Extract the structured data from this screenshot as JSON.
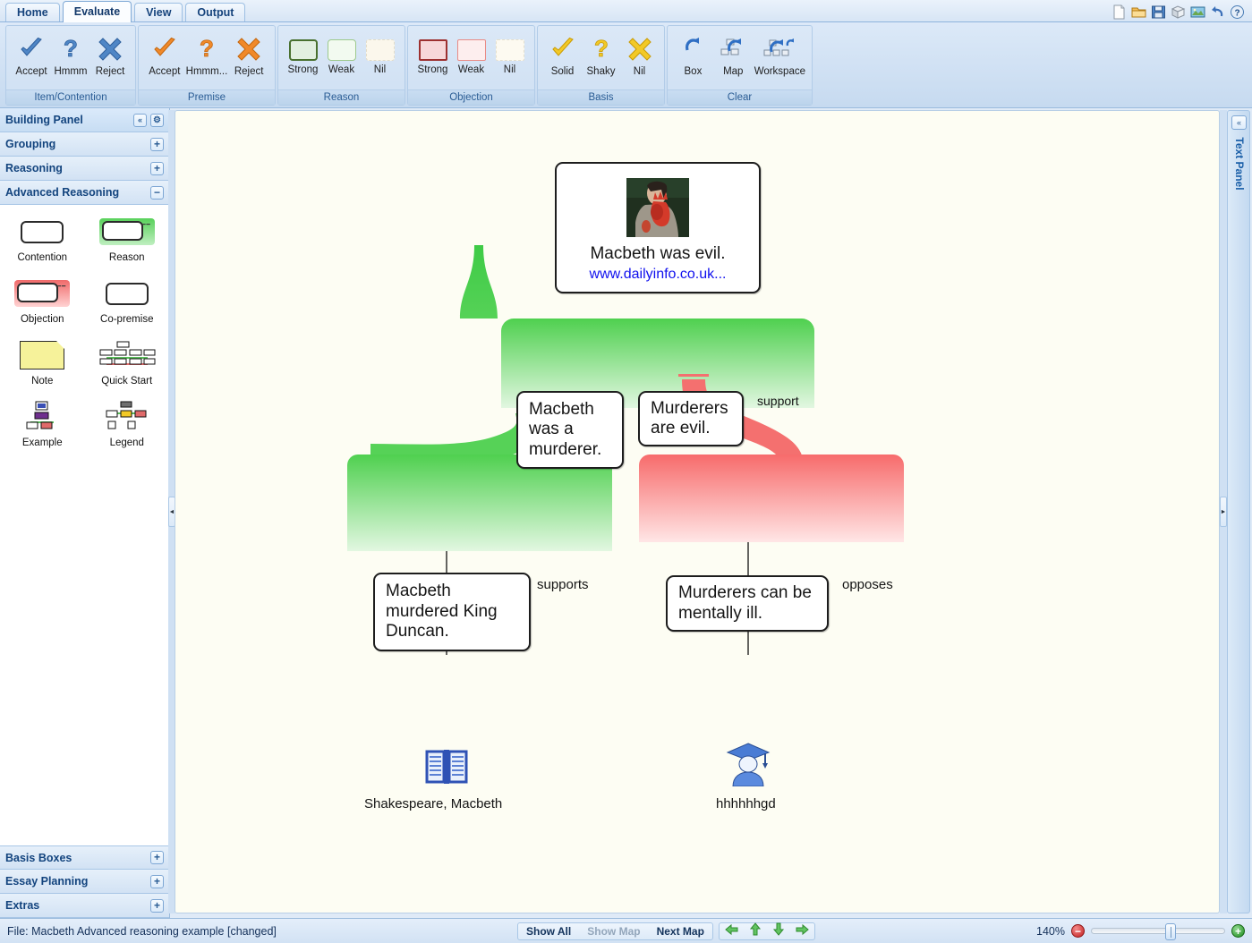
{
  "window": {
    "tabs": [
      {
        "label": "Home",
        "active": false
      },
      {
        "label": "Evaluate",
        "active": true
      },
      {
        "label": "View",
        "active": false
      },
      {
        "label": "Output",
        "active": false
      }
    ],
    "quick_access": [
      {
        "icon": "new-document-icon"
      },
      {
        "icon": "open-folder-icon"
      },
      {
        "icon": "save-disk-icon"
      },
      {
        "icon": "package-box-icon"
      },
      {
        "icon": "export-image-icon"
      },
      {
        "icon": "undo-arrow-icon"
      },
      {
        "icon": "help-question-icon"
      }
    ]
  },
  "ribbon": {
    "groups": [
      {
        "title": "Item/Contention",
        "items": [
          {
            "label": "Accept",
            "icon": "blue-check-icon"
          },
          {
            "label": "Hmmm",
            "icon": "blue-question-icon"
          },
          {
            "label": "Reject",
            "icon": "blue-cross-icon"
          }
        ]
      },
      {
        "title": "Premise",
        "items": [
          {
            "label": "Accept",
            "icon": "orange-check-icon"
          },
          {
            "label": "Hmmm...",
            "icon": "orange-question-icon"
          },
          {
            "label": "Reject",
            "icon": "orange-cross-icon"
          }
        ]
      },
      {
        "title": "Reason",
        "items": [
          {
            "label": "Strong",
            "icon": "green-strong-swatch"
          },
          {
            "label": "Weak",
            "icon": "green-weak-swatch"
          },
          {
            "label": "Nil",
            "icon": "nil-swatch"
          }
        ]
      },
      {
        "title": "Objection",
        "items": [
          {
            "label": "Strong",
            "icon": "red-strong-swatch"
          },
          {
            "label": "Weak",
            "icon": "red-weak-swatch"
          },
          {
            "label": "Nil",
            "icon": "nil-swatch"
          }
        ]
      },
      {
        "title": "Basis",
        "items": [
          {
            "label": "Solid",
            "icon": "yellow-check-icon"
          },
          {
            "label": "Shaky",
            "icon": "yellow-question-icon"
          },
          {
            "label": "Nil",
            "icon": "yellow-cross-icon"
          }
        ]
      },
      {
        "title": "Clear",
        "items": [
          {
            "label": "Box",
            "icon": "clear-box-icon"
          },
          {
            "label": "Map",
            "icon": "clear-map-icon"
          },
          {
            "label": "Workspace",
            "icon": "clear-workspace-icon"
          }
        ]
      }
    ]
  },
  "building_panel": {
    "title": "Building Panel",
    "collapse_icon": "double-chevron-left-icon",
    "settings_icon": "gear-icon",
    "sections": [
      {
        "label": "Grouping",
        "state": "+"
      },
      {
        "label": "Reasoning",
        "state": "+"
      },
      {
        "label": "Advanced Reasoning",
        "state": "−"
      }
    ],
    "palette": [
      {
        "label": "Contention",
        "art": "contention-box"
      },
      {
        "label": "Reason",
        "art": "reason-box"
      },
      {
        "label": "Objection",
        "art": "objection-box"
      },
      {
        "label": "Co-premise",
        "art": "copremise-box"
      },
      {
        "label": "Note",
        "art": "note-sticky"
      },
      {
        "label": "Quick Start",
        "art": "quickstart-map"
      },
      {
        "label": "Example",
        "art": "example-map"
      },
      {
        "label": "Legend",
        "art": "legend-map"
      }
    ],
    "bottom_sections": [
      {
        "label": "Basis Boxes",
        "state": "+"
      },
      {
        "label": "Essay Planning",
        "state": "+"
      },
      {
        "label": "Extras",
        "state": "+"
      }
    ]
  },
  "text_panel": {
    "label": "Text Panel",
    "collapse_icon": "double-chevron-right-icon"
  },
  "map": {
    "contention": {
      "text": "Macbeth was evil.",
      "link": "www.dailyinfo.co.uk...",
      "image": "macbeth-bloody-hand-photo"
    },
    "support_region_label": "support",
    "reason_boxes": [
      {
        "text": "Macbeth was a murderer."
      },
      {
        "text": "Murderers are evil."
      }
    ],
    "supports_region_label": "supports",
    "supports_box": {
      "text": "Macbeth murdered King Duncan."
    },
    "opposes_region_label": "opposes",
    "opposes_box": {
      "text": "Murderers can be mentally ill."
    },
    "basis_items": [
      {
        "label": "Shakespeare, Macbeth",
        "icon": "open-book-icon"
      },
      {
        "label": "hhhhhhgd",
        "icon": "graduate-person-icon"
      }
    ]
  },
  "statusbar": {
    "file_text": "File: Macbeth Advanced reasoning example [changed]",
    "buttons": [
      {
        "label": "Show All",
        "disabled": false
      },
      {
        "label": "Show Map",
        "disabled": true
      },
      {
        "label": "Next Map",
        "disabled": false
      }
    ],
    "arrows": [
      {
        "icon": "arrow-left-icon"
      },
      {
        "icon": "arrow-up-icon"
      },
      {
        "icon": "arrow-down-icon"
      },
      {
        "icon": "arrow-right-icon"
      }
    ],
    "zoom_level": "140%",
    "zoom_out_icon": "zoom-out-icon",
    "zoom_in_icon": "zoom-in-icon"
  }
}
